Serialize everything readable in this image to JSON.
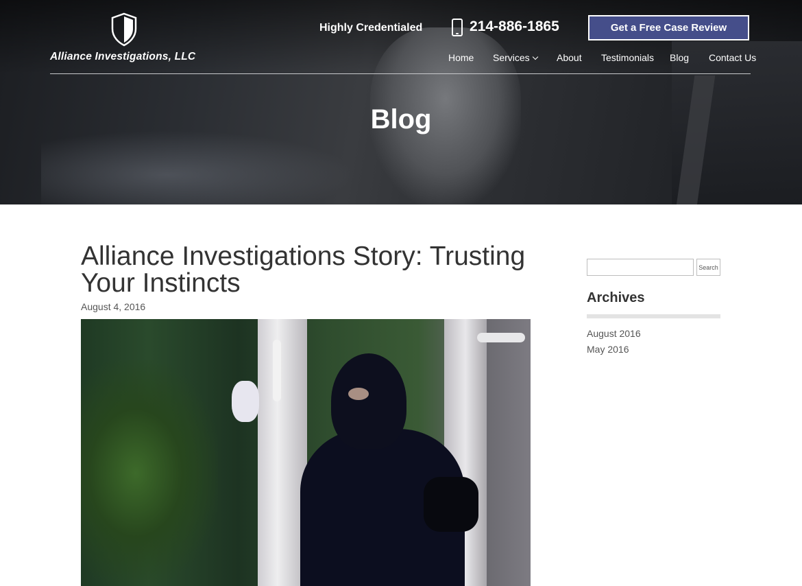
{
  "brand": {
    "name": "Alliance Investigations, LLC"
  },
  "header": {
    "tagline": "Highly Credentialed",
    "phone": "214-886-1865",
    "cta_label": "Get a Free Case Review"
  },
  "nav": {
    "items": [
      {
        "label": "Home"
      },
      {
        "label": "Services"
      },
      {
        "label": "About"
      },
      {
        "label": "Testimonials"
      },
      {
        "label": "Blog"
      },
      {
        "label": "Contact Us"
      }
    ]
  },
  "hero": {
    "title": "Blog"
  },
  "post": {
    "title": "Alliance Investigations Story: Trusting Your Instincts",
    "date": "August 4, 2016"
  },
  "sidebar": {
    "search": {
      "placeholder": "",
      "button_label": "Search"
    },
    "archives": {
      "title": "Archives",
      "items": [
        {
          "label": "August 2016"
        },
        {
          "label": "May 2016"
        }
      ]
    }
  },
  "colors": {
    "cta_bg": "#454e8a",
    "text": "#333333"
  }
}
